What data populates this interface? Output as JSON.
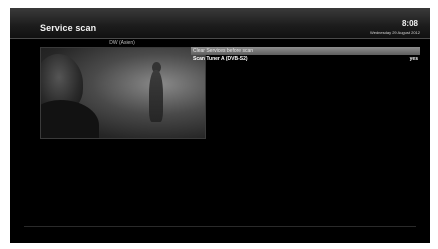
{
  "header": {
    "title": "Service scan",
    "time": "8:08",
    "date": "Wednesday 29 August 2012"
  },
  "preview": {
    "channel_name": "DW (Asien)"
  },
  "menu": {
    "items": [
      {
        "label": "Clear Services before scan",
        "value": ""
      },
      {
        "label": "Scan Tuner A (DVB-S2)",
        "value": "yes"
      }
    ],
    "selected_index": 0
  },
  "colors": {
    "background": "#000000",
    "header_gradient_top": "#3a3a3a",
    "selection_bar": "#7a7a7a",
    "text": "#ffffff"
  }
}
